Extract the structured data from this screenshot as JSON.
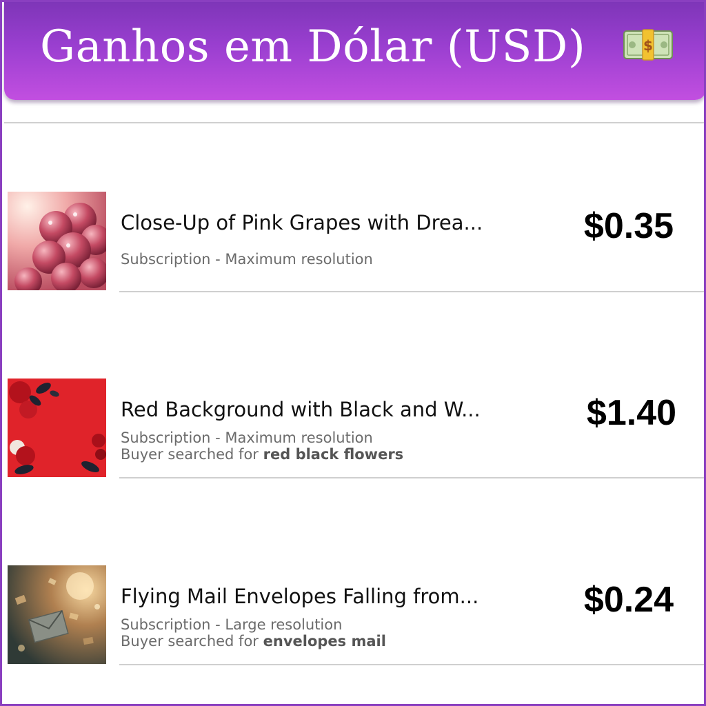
{
  "header": {
    "title": "Ganhos em Dólar (USD)",
    "icon": "money-with-wings-icon"
  },
  "sales": [
    {
      "title": "Close-Up of Pink Grapes with Drea...",
      "subtitle": "Subscription - Maximum resolution",
      "price": "$0.35",
      "thumbnail_icon": "pink-grapes-thumbnail"
    },
    {
      "title": "Red Background with Black and W...",
      "subtitle": "Subscription - Maximum resolution",
      "search_prefix": "Buyer searched for",
      "search_term": "red black flowers",
      "price": "$1.40",
      "thumbnail_icon": "red-flowers-thumbnail"
    },
    {
      "title": "Flying Mail Envelopes Falling from...",
      "subtitle": "Subscription - Large resolution",
      "search_prefix": "Buyer searched for",
      "search_term": "envelopes mail",
      "price": "$0.24",
      "thumbnail_icon": "mail-envelopes-thumbnail"
    }
  ],
  "colors": {
    "header_gradient_start": "#7e35b8",
    "header_gradient_end": "#c24fe0",
    "frame_border": "#8a3fc0"
  }
}
